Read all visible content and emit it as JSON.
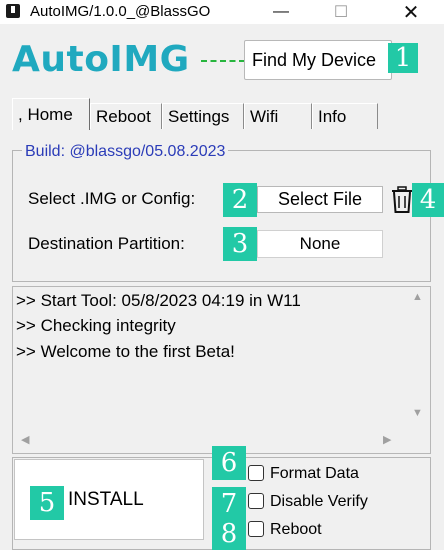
{
  "window": {
    "title": "AutoIMG/1.0.0_@BlassGO",
    "controls": {
      "minimize": "—",
      "maximize": "☐",
      "close": "✕"
    }
  },
  "header": {
    "logo": "AutoIMG",
    "find_device_label": "Find My Device",
    "accent_color": "#20a9bf",
    "connector_color": "#27b53e"
  },
  "tabs": [
    {
      "label": ", Home",
      "active": true
    },
    {
      "label": "Reboot",
      "active": false
    },
    {
      "label": "Settings",
      "active": false
    },
    {
      "label": "Wifi",
      "active": false
    },
    {
      "label": "Info",
      "active": false
    }
  ],
  "build": {
    "label": "Build: @blassgo/05.08.2023",
    "label_color": "#2b3cb8",
    "select_label": "Select .IMG or Config:",
    "select_button": "Select File",
    "destination_label": "Destination Partition:",
    "destination_value": "None"
  },
  "log": {
    "lines": [
      ">> Start Tool: 05/8/2023   04:19 in W11",
      ">> Checking integrity",
      ">> Welcome to the first Beta!"
    ]
  },
  "actions": {
    "install_label": "INSTALL",
    "options": [
      {
        "label": "Format Data",
        "checked": false
      },
      {
        "label": "Disable Verify",
        "checked": false
      },
      {
        "label": "Reboot",
        "checked": false
      }
    ]
  },
  "badges": [
    "1",
    "2",
    "3",
    "4",
    "5",
    "6",
    "7",
    "8"
  ],
  "badge_color": "#22c9a6"
}
